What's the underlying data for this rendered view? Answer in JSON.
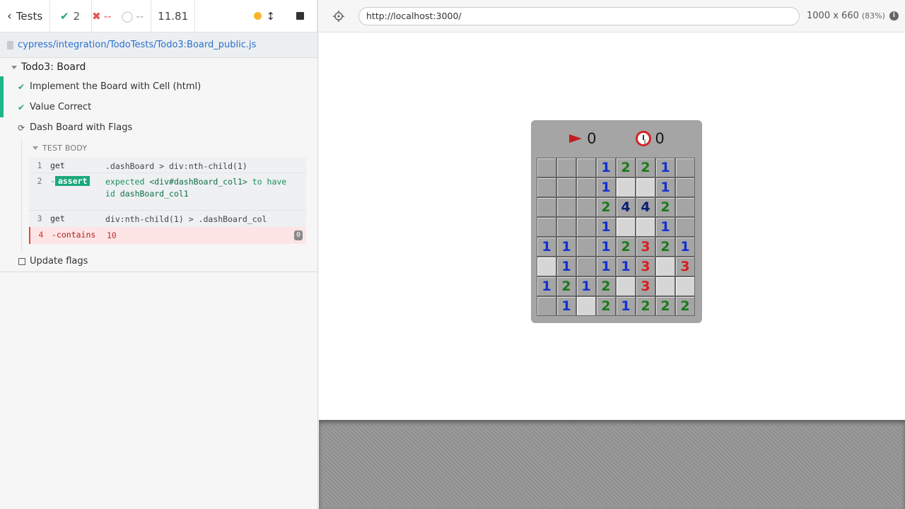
{
  "stats": {
    "tests_label": "Tests",
    "passed": "2",
    "failed": "--",
    "pending": "--",
    "duration": "11.81"
  },
  "spec_path": "cypress/integration/TodoTests/Todo3:Board_public.js",
  "suite": {
    "title": "Todo3: Board",
    "tests": [
      {
        "label": "Implement the Board with Cell (html)",
        "state": "passed"
      },
      {
        "label": "Value Correct",
        "state": "passed"
      },
      {
        "label": "Dash Board with Flags",
        "state": "running"
      }
    ],
    "test_body_label": "TEST BODY",
    "commands": [
      {
        "num": "1",
        "name": "get",
        "msg": ".dashBoard > div:nth-child(1)"
      },
      {
        "num": "2",
        "name": "assert",
        "msg_prefix": "expected",
        "msg_el": "<div#dashBoard_col1>",
        "msg_mid": "to have",
        "msg_id": "id",
        "msg_val": "dashBoard_col1"
      },
      {
        "num": "3",
        "name": "get",
        "msg": "div:nth-child(1) > .dashBoard_col"
      },
      {
        "num": "4",
        "name": "-contains",
        "msg": "10",
        "badge": "0"
      }
    ],
    "pending_test": "Update flags"
  },
  "aut": {
    "url": "http://localhost:3000/",
    "viewport": "1000 x 660",
    "scale": "(83%)"
  },
  "board": {
    "flags": "0",
    "time": "0",
    "cells": [
      [
        "",
        "",
        "",
        "1",
        "2",
        "2",
        "1",
        ""
      ],
      [
        "",
        "",
        "",
        "1",
        "_",
        "_",
        "1",
        ""
      ],
      [
        "",
        "",
        "",
        "2",
        "4",
        "4",
        "2",
        ""
      ],
      [
        "",
        "",
        "",
        "1",
        "_",
        "_",
        "1",
        ""
      ],
      [
        "1",
        "1",
        "",
        "1",
        "2",
        "3",
        "2",
        "1"
      ],
      [
        "_",
        "1",
        "",
        "1",
        "1",
        "3",
        "_",
        "3"
      ],
      [
        "1",
        "2",
        "1",
        "2",
        "_",
        "3",
        "_",
        "_"
      ],
      [
        "",
        "1",
        "_",
        "2",
        "1",
        "2",
        "2",
        "2"
      ]
    ]
  }
}
